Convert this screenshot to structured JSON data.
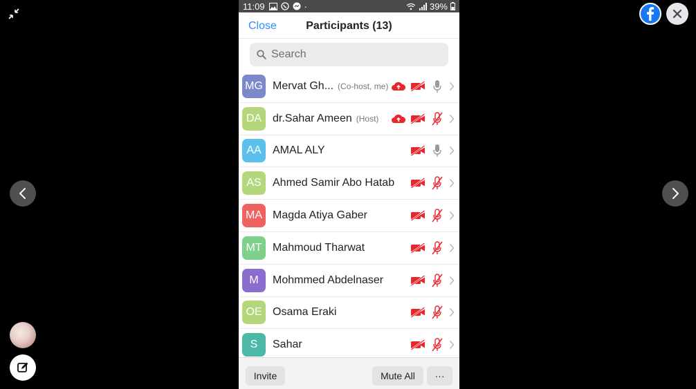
{
  "status_bar": {
    "time": "11:09",
    "battery": "39%",
    "dot": "·"
  },
  "header": {
    "close_label": "Close",
    "title": "Participants (13)"
  },
  "search": {
    "placeholder": "Search"
  },
  "participants": [
    {
      "initials": "MG",
      "name": "Mervat Gh...",
      "role": "(Co-host, me)",
      "avatar_color": "#7b88c9",
      "cloud": true,
      "mic_muted": false
    },
    {
      "initials": "DA",
      "name": "dr.Sahar Ameen",
      "role": "(Host)",
      "avatar_color": "#b5d77c",
      "cloud": true,
      "mic_muted": true
    },
    {
      "initials": "AA",
      "name": "AMAL ALY",
      "role": "",
      "avatar_color": "#5bc0eb",
      "cloud": false,
      "mic_muted": false
    },
    {
      "initials": "AS",
      "name": "Ahmed Samir Abo Hatab",
      "role": "",
      "avatar_color": "#b5d77c",
      "cloud": false,
      "mic_muted": true
    },
    {
      "initials": "MA",
      "name": "Magda Atiya Gaber",
      "role": "",
      "avatar_color": "#f0625f",
      "cloud": false,
      "mic_muted": true
    },
    {
      "initials": "MT",
      "name": "Mahmoud Tharwat",
      "role": "",
      "avatar_color": "#7ed08a",
      "cloud": false,
      "mic_muted": true
    },
    {
      "initials": "M",
      "name": "Mohmmed  Abdelnaser",
      "role": "",
      "avatar_color": "#8d6ccf",
      "cloud": false,
      "mic_muted": true
    },
    {
      "initials": "OE",
      "name": "Osama Eraki",
      "role": "",
      "avatar_color": "#b5d77c",
      "cloud": false,
      "mic_muted": true
    },
    {
      "initials": "S",
      "name": "Sahar",
      "role": "",
      "avatar_color": "#4cb9a8",
      "cloud": false,
      "mic_muted": true
    }
  ],
  "footer": {
    "invite_label": "Invite",
    "mute_all_label": "Mute All",
    "more_label": "···"
  },
  "colors": {
    "accent": "#2d8cff",
    "muted_red": "#e8262b",
    "mic_gray": "#9a9a9a"
  }
}
